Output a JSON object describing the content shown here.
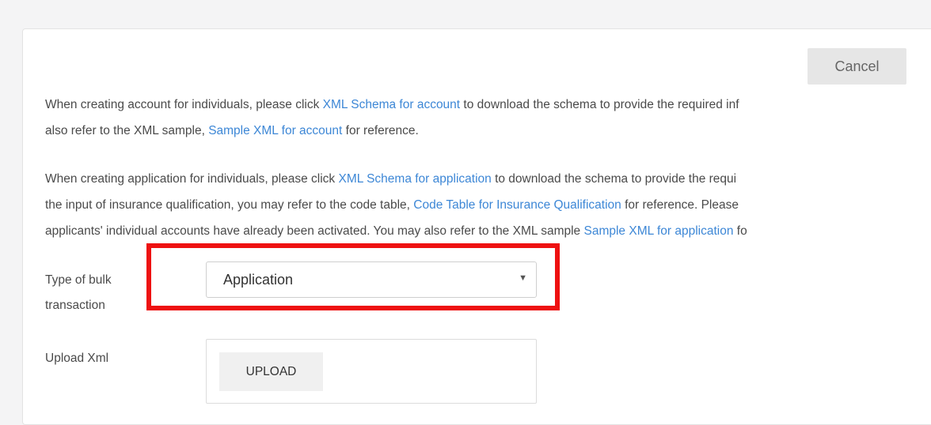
{
  "cancel_label": "Cancel",
  "account_para": {
    "line1_pre": "When creating account for individuals, please click ",
    "line1_link": "XML Schema for account",
    "line1_post": " to download the schema to provide the required inf",
    "line2_pre": "also refer to the XML sample, ",
    "line2_link": "Sample XML for account",
    "line2_post": " for reference."
  },
  "application_para": {
    "line1_pre": "When creating application for individuals, please click ",
    "line1_link": "XML Schema for application",
    "line1_post": " to download the schema to provide the requi",
    "line2_pre": "the input of insurance qualification, you may refer to the code table, ",
    "line2_link": "Code Table for Insurance Qualification",
    "line2_post": " for reference. Please",
    "line3_pre": "applicants' individual accounts have already been activated. You may also refer to the XML sample ",
    "line3_link": "Sample XML for application",
    "line3_post": " fo"
  },
  "bulk_type": {
    "label": "Type of bulk transaction",
    "selected": "Application"
  },
  "upload": {
    "label": "Upload Xml",
    "button_label": "UPLOAD"
  },
  "colors": {
    "link": "#3d87d6",
    "highlight": "#ee1111"
  }
}
